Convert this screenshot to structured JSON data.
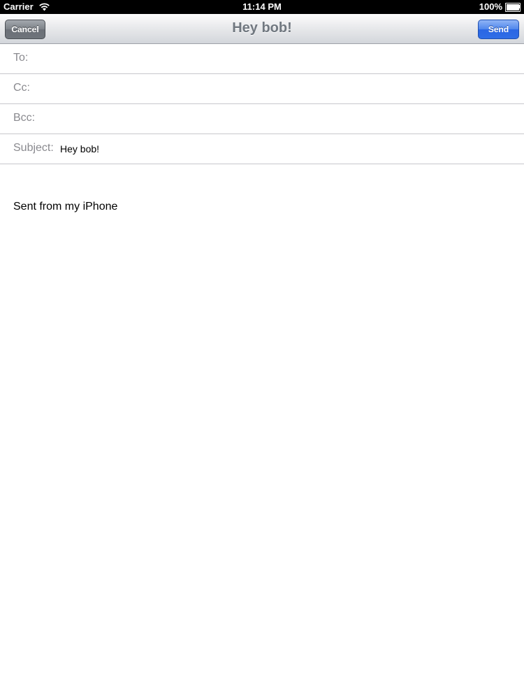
{
  "status_bar": {
    "carrier": "Carrier",
    "time": "11:14 PM",
    "battery": "100%",
    "battery_level": 1.0,
    "wifi_icon": "wifi-icon",
    "battery_icon": "battery-icon"
  },
  "nav": {
    "title": "Hey bob!",
    "cancel_label": "Cancel",
    "send_label": "Send"
  },
  "fields": {
    "to_label": "To:",
    "to_value": "",
    "cc_label": "Cc:",
    "cc_value": "",
    "bcc_label": "Bcc:",
    "bcc_value": "",
    "subject_label": "Subject:",
    "subject_value": "Hey bob!"
  },
  "body": {
    "text": "",
    "signature": "Sent from my iPhone"
  },
  "colors": {
    "send_button": "#2f6de6",
    "cancel_button": "#7c8188",
    "label_gray": "#8a8a8f"
  }
}
